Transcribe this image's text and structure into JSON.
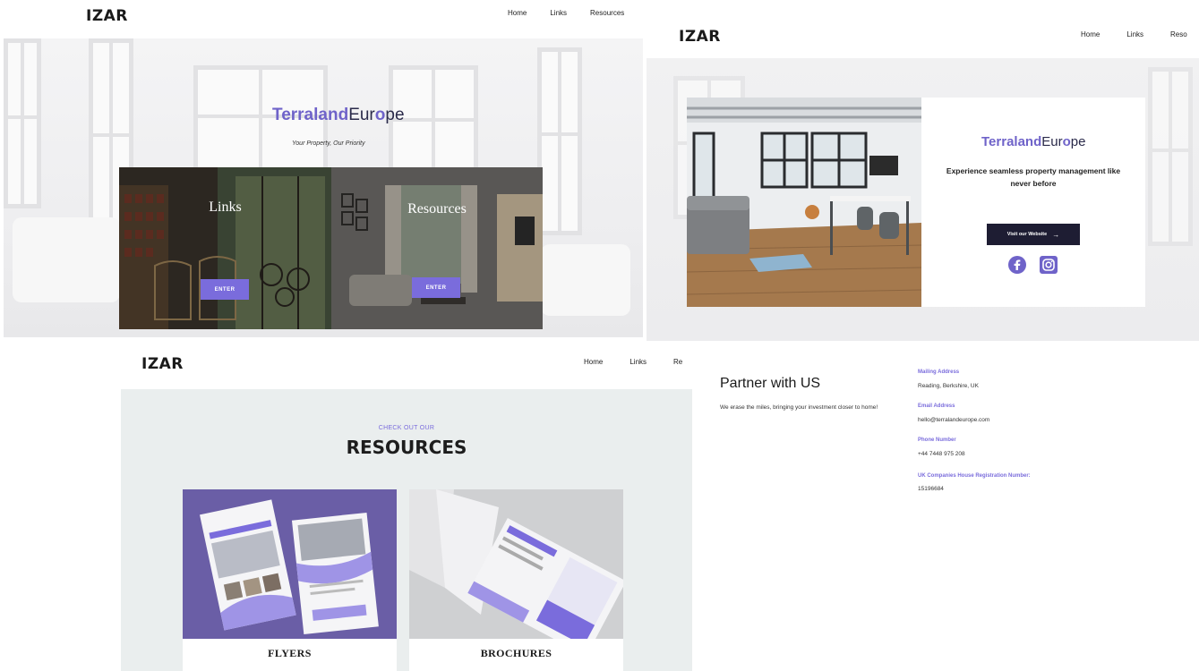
{
  "brand": {
    "logo": "IZAR",
    "name_part1": "Terraland",
    "name_part2_pre": "Eur",
    "name_part2_post": "pe",
    "name_o": "o"
  },
  "nav": {
    "home": "Home",
    "links": "Links",
    "resources": "Resources",
    "resources_truncated": "Reso",
    "resources_cut": "Re"
  },
  "hero": {
    "tagline": "Your Property, Our Priority",
    "cards": [
      {
        "title": "Links",
        "button": "ENTER"
      },
      {
        "title": "Resources",
        "button": "ENTER"
      }
    ]
  },
  "promo": {
    "description": "Experience seamless property management like never before",
    "button": "Visit our Website",
    "button_arrow": "→",
    "socials": [
      "facebook-icon",
      "instagram-icon"
    ]
  },
  "resources": {
    "eyebrow": "CHECK OUT OUR",
    "heading": "RESOURCES",
    "items": [
      {
        "label": "FLYERS"
      },
      {
        "label": "BROCHURES"
      }
    ]
  },
  "contact": {
    "title": "Partner with US",
    "description": "We erase the miles, bringing your investment closer to home!",
    "fields": [
      {
        "label": "Mailing Address",
        "value": "Reading, Berkshire, UK"
      },
      {
        "label": "Email Address",
        "value": "hello@terralandeurope.com"
      },
      {
        "label": "Phone Number",
        "value": "+44 7448 975 208"
      },
      {
        "label": "UK Companies House Registration Number:",
        "value": "15196684"
      }
    ]
  },
  "colors": {
    "accent": "#7a6cdc",
    "dark_button": "#1e1d33",
    "section_bg": "#eaeeee",
    "flyer_bg": "#6a5ea6"
  }
}
